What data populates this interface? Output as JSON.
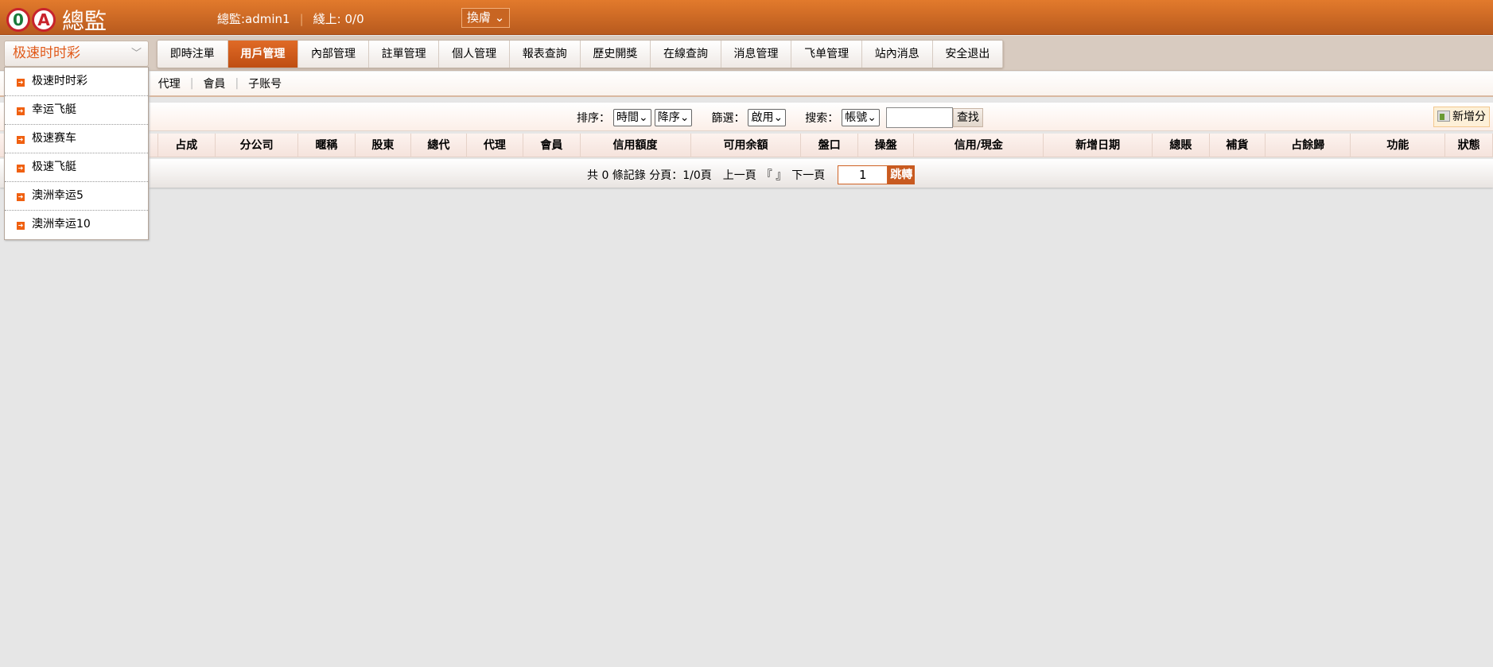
{
  "header": {
    "logo_text": "OA",
    "title": "總監",
    "user": "總監:admin1",
    "online": "綫上: 0/0",
    "skin_label": "換膚"
  },
  "game_select": {
    "value": "极速时时彩",
    "options": [
      "极速时时彩",
      "幸运飞艇",
      "极速赛车",
      "极速飞艇",
      "澳洲幸运5",
      "澳洲幸运10"
    ]
  },
  "nav": {
    "tabs": [
      "即時注單",
      "用戶管理",
      "內部管理",
      "註單管理",
      "個人管理",
      "報表查詢",
      "歷史開獎",
      "在線查詢",
      "消息管理",
      "飞单管理",
      "站內消息",
      "安全退出"
    ],
    "active": "用戶管理"
  },
  "subnav": [
    "代理",
    "會員",
    "子账号"
  ],
  "toolbar": {
    "sort_label": "排序：",
    "sort_field": "時間",
    "sort_order": "降序",
    "filter_label": "篩選：",
    "filter_value": "啟用",
    "search_label": "搜索：",
    "search_field": "帳號",
    "search_value": "",
    "search_button": "查找",
    "add_button": "新增分"
  },
  "table": {
    "columns": [
      "",
      "占成",
      "分公司",
      "暱稱",
      "股東",
      "總代",
      "代理",
      "會員",
      "信用額度",
      "可用余額",
      "盤口",
      "操盤",
      "信用/現金",
      "新增日期",
      "總賬",
      "補貨",
      "占餘歸",
      "功能",
      "狀態"
    ]
  },
  "pager": {
    "summary": "共 0 條記錄 分頁：1/0頁",
    "prev": "上一頁",
    "brackets": "『 』",
    "next": "下一頁",
    "page_value": "1",
    "go_button": "跳轉"
  },
  "colors": {
    "accent": "#c85a20",
    "header": "#e27a2c"
  }
}
